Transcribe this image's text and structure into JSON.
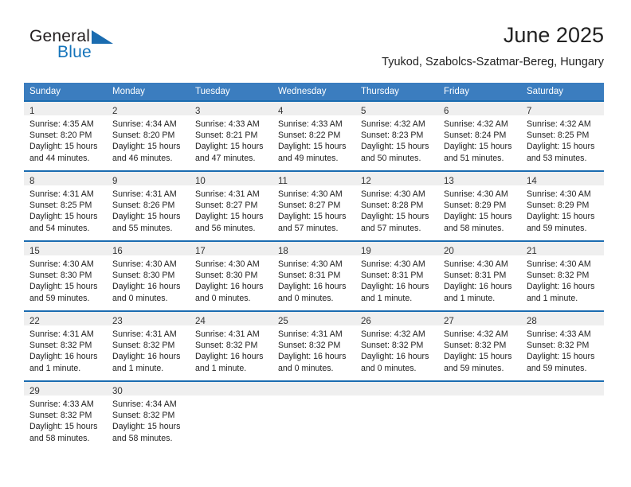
{
  "brand": {
    "name_top": "General",
    "name_bottom": "Blue",
    "triangle_icon": "triangle-icon",
    "accent_color": "#1b6cb0"
  },
  "header": {
    "title": "June 2025",
    "subtitle": "Tyukod, Szabolcs-Szatmar-Bereg, Hungary"
  },
  "calendar": {
    "header_bg": "#3b7dbf",
    "row_border_color": "#1b6cb0",
    "daynum_bg": "#efefef",
    "weekday_headers": [
      "Sunday",
      "Monday",
      "Tuesday",
      "Wednesday",
      "Thursday",
      "Friday",
      "Saturday"
    ],
    "weeks": [
      [
        {
          "day": "1",
          "sunrise": "Sunrise: 4:35 AM",
          "sunset": "Sunset: 8:20 PM",
          "daylight": "Daylight: 15 hours and 44 minutes."
        },
        {
          "day": "2",
          "sunrise": "Sunrise: 4:34 AM",
          "sunset": "Sunset: 8:20 PM",
          "daylight": "Daylight: 15 hours and 46 minutes."
        },
        {
          "day": "3",
          "sunrise": "Sunrise: 4:33 AM",
          "sunset": "Sunset: 8:21 PM",
          "daylight": "Daylight: 15 hours and 47 minutes."
        },
        {
          "day": "4",
          "sunrise": "Sunrise: 4:33 AM",
          "sunset": "Sunset: 8:22 PM",
          "daylight": "Daylight: 15 hours and 49 minutes."
        },
        {
          "day": "5",
          "sunrise": "Sunrise: 4:32 AM",
          "sunset": "Sunset: 8:23 PM",
          "daylight": "Daylight: 15 hours and 50 minutes."
        },
        {
          "day": "6",
          "sunrise": "Sunrise: 4:32 AM",
          "sunset": "Sunset: 8:24 PM",
          "daylight": "Daylight: 15 hours and 51 minutes."
        },
        {
          "day": "7",
          "sunrise": "Sunrise: 4:32 AM",
          "sunset": "Sunset: 8:25 PM",
          "daylight": "Daylight: 15 hours and 53 minutes."
        }
      ],
      [
        {
          "day": "8",
          "sunrise": "Sunrise: 4:31 AM",
          "sunset": "Sunset: 8:25 PM",
          "daylight": "Daylight: 15 hours and 54 minutes."
        },
        {
          "day": "9",
          "sunrise": "Sunrise: 4:31 AM",
          "sunset": "Sunset: 8:26 PM",
          "daylight": "Daylight: 15 hours and 55 minutes."
        },
        {
          "day": "10",
          "sunrise": "Sunrise: 4:31 AM",
          "sunset": "Sunset: 8:27 PM",
          "daylight": "Daylight: 15 hours and 56 minutes."
        },
        {
          "day": "11",
          "sunrise": "Sunrise: 4:30 AM",
          "sunset": "Sunset: 8:27 PM",
          "daylight": "Daylight: 15 hours and 57 minutes."
        },
        {
          "day": "12",
          "sunrise": "Sunrise: 4:30 AM",
          "sunset": "Sunset: 8:28 PM",
          "daylight": "Daylight: 15 hours and 57 minutes."
        },
        {
          "day": "13",
          "sunrise": "Sunrise: 4:30 AM",
          "sunset": "Sunset: 8:29 PM",
          "daylight": "Daylight: 15 hours and 58 minutes."
        },
        {
          "day": "14",
          "sunrise": "Sunrise: 4:30 AM",
          "sunset": "Sunset: 8:29 PM",
          "daylight": "Daylight: 15 hours and 59 minutes."
        }
      ],
      [
        {
          "day": "15",
          "sunrise": "Sunrise: 4:30 AM",
          "sunset": "Sunset: 8:30 PM",
          "daylight": "Daylight: 15 hours and 59 minutes."
        },
        {
          "day": "16",
          "sunrise": "Sunrise: 4:30 AM",
          "sunset": "Sunset: 8:30 PM",
          "daylight": "Daylight: 16 hours and 0 minutes."
        },
        {
          "day": "17",
          "sunrise": "Sunrise: 4:30 AM",
          "sunset": "Sunset: 8:30 PM",
          "daylight": "Daylight: 16 hours and 0 minutes."
        },
        {
          "day": "18",
          "sunrise": "Sunrise: 4:30 AM",
          "sunset": "Sunset: 8:31 PM",
          "daylight": "Daylight: 16 hours and 0 minutes."
        },
        {
          "day": "19",
          "sunrise": "Sunrise: 4:30 AM",
          "sunset": "Sunset: 8:31 PM",
          "daylight": "Daylight: 16 hours and 1 minute."
        },
        {
          "day": "20",
          "sunrise": "Sunrise: 4:30 AM",
          "sunset": "Sunset: 8:31 PM",
          "daylight": "Daylight: 16 hours and 1 minute."
        },
        {
          "day": "21",
          "sunrise": "Sunrise: 4:30 AM",
          "sunset": "Sunset: 8:32 PM",
          "daylight": "Daylight: 16 hours and 1 minute."
        }
      ],
      [
        {
          "day": "22",
          "sunrise": "Sunrise: 4:31 AM",
          "sunset": "Sunset: 8:32 PM",
          "daylight": "Daylight: 16 hours and 1 minute."
        },
        {
          "day": "23",
          "sunrise": "Sunrise: 4:31 AM",
          "sunset": "Sunset: 8:32 PM",
          "daylight": "Daylight: 16 hours and 1 minute."
        },
        {
          "day": "24",
          "sunrise": "Sunrise: 4:31 AM",
          "sunset": "Sunset: 8:32 PM",
          "daylight": "Daylight: 16 hours and 1 minute."
        },
        {
          "day": "25",
          "sunrise": "Sunrise: 4:31 AM",
          "sunset": "Sunset: 8:32 PM",
          "daylight": "Daylight: 16 hours and 0 minutes."
        },
        {
          "day": "26",
          "sunrise": "Sunrise: 4:32 AM",
          "sunset": "Sunset: 8:32 PM",
          "daylight": "Daylight: 16 hours and 0 minutes."
        },
        {
          "day": "27",
          "sunrise": "Sunrise: 4:32 AM",
          "sunset": "Sunset: 8:32 PM",
          "daylight": "Daylight: 15 hours and 59 minutes."
        },
        {
          "day": "28",
          "sunrise": "Sunrise: 4:33 AM",
          "sunset": "Sunset: 8:32 PM",
          "daylight": "Daylight: 15 hours and 59 minutes."
        }
      ],
      [
        {
          "day": "29",
          "sunrise": "Sunrise: 4:33 AM",
          "sunset": "Sunset: 8:32 PM",
          "daylight": "Daylight: 15 hours and 58 minutes."
        },
        {
          "day": "30",
          "sunrise": "Sunrise: 4:34 AM",
          "sunset": "Sunset: 8:32 PM",
          "daylight": "Daylight: 15 hours and 58 minutes."
        },
        {
          "day": "",
          "sunrise": "",
          "sunset": "",
          "daylight": ""
        },
        {
          "day": "",
          "sunrise": "",
          "sunset": "",
          "daylight": ""
        },
        {
          "day": "",
          "sunrise": "",
          "sunset": "",
          "daylight": ""
        },
        {
          "day": "",
          "sunrise": "",
          "sunset": "",
          "daylight": ""
        },
        {
          "day": "",
          "sunrise": "",
          "sunset": "",
          "daylight": ""
        }
      ]
    ]
  }
}
